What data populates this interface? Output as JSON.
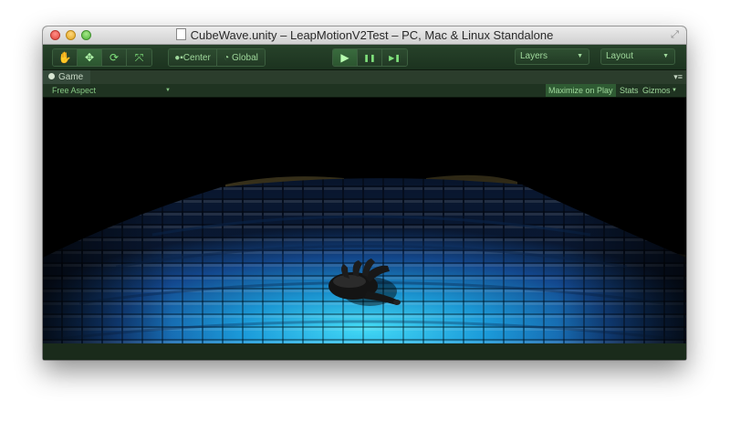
{
  "window": {
    "title": "CubeWave.unity – LeapMotionV2Test – PC, Mac & Linux Standalone"
  },
  "toolbar": {
    "transform_tools": [
      {
        "icon": "hand-icon",
        "glyph": "✋"
      },
      {
        "icon": "move-icon",
        "glyph": "✥"
      },
      {
        "icon": "rotate-icon",
        "glyph": "⟳"
      },
      {
        "icon": "scale-icon",
        "glyph": "⤧"
      }
    ],
    "pivot_label": "Center",
    "space_label": "Global",
    "play_glyph": "▶",
    "pause_glyph": "❚❚",
    "step_glyph": "▶❚",
    "layers_label": "Layers",
    "layout_label": "Layout"
  },
  "tab": {
    "label": "Game"
  },
  "gamebar": {
    "aspect_label": "Free Aspect",
    "maximize_label": "Maximize on Play",
    "stats_label": "Stats",
    "gizmos_label": "Gizmos"
  },
  "colors": {
    "toolbar_green": "#27422a",
    "accent_green": "#7fe07b",
    "cube_cyan": "#3fd8f5",
    "cube_blue": "#1a4fa8"
  }
}
